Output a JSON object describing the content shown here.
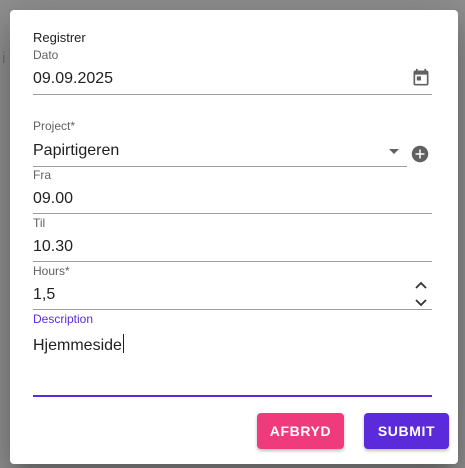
{
  "dialog": {
    "title": "Registrer",
    "date": {
      "label": "Dato",
      "value": "09.09.2025",
      "icon": "calendar-icon"
    },
    "project": {
      "label": "Project*",
      "value": "Papirtigeren",
      "dropdown_icon": "chevron-down-icon",
      "add_icon": "add-circle-icon"
    },
    "from": {
      "label": "Fra",
      "value": "09.00"
    },
    "to": {
      "label": "Til",
      "value": "10.30"
    },
    "hours": {
      "label": "Hours*",
      "value": "1,5",
      "stepper_icon": "stepper-icon"
    },
    "description": {
      "label": "Description",
      "value": "Hjemmeside"
    },
    "buttons": {
      "cancel": "AFBRYD",
      "submit": "SUBMIT"
    }
  },
  "colors": {
    "accent": "#5b2bdb",
    "cancel_button": "#ef3b7c",
    "submit_button": "#5b2bdb"
  }
}
